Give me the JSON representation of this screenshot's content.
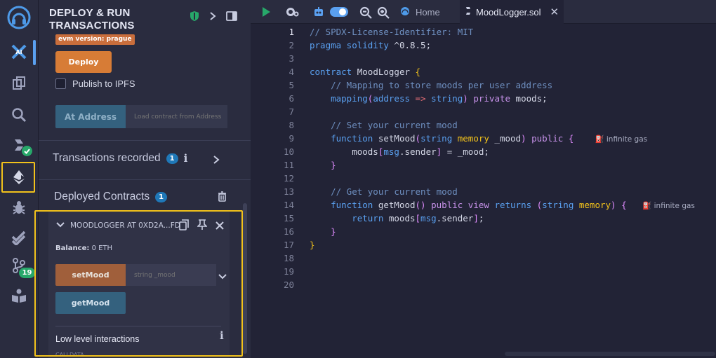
{
  "panel": {
    "title": "DEPLOY & RUN TRANSACTIONS",
    "evm_version": "evm version: prague",
    "deploy_label": "Deploy",
    "publish_ipfs_label": "Publish to IPFS",
    "at_address_label": "At Address",
    "at_address_placeholder": "Load contract from Address",
    "transactions_label": "Transactions recorded",
    "transactions_count": "1",
    "deployed_label": "Deployed Contracts",
    "deployed_count": "1",
    "instance": {
      "title": "MOODLOGGER AT 0XD2A...FD",
      "balance_label": "Balance:",
      "balance_value": "0 ETH",
      "setmood_label": "setMood",
      "setmood_placeholder": "string _mood",
      "getmood_label": "getMood",
      "low_level_label": "Low level interactions",
      "calldata_label": "CALLDATA"
    }
  },
  "iconbar": {
    "badge_count": "19",
    "icons": [
      "remix-logo-icon",
      "ai-icon",
      "file-explorer-icon",
      "search-icon",
      "solidity-compiler-icon",
      "deploy-run-icon",
      "debugger-icon",
      "test-icon",
      "git-icon",
      "learn-icon"
    ]
  },
  "tabs": {
    "home_label": "Home",
    "file_label": "MoodLogger.sol"
  },
  "editor": {
    "line_numbers": [
      "1",
      "2",
      "3",
      "4",
      "5",
      "6",
      "7",
      "8",
      "9",
      "10",
      "11",
      "12",
      "13",
      "14",
      "15",
      "16",
      "17",
      "18",
      "19",
      "20"
    ],
    "lines": {
      "l1": "// SPDX-License-Identifier: MIT",
      "l2_kw": "pragma solidity",
      "l2_ver": " ^0.8.5;",
      "l4_kw": "contract",
      "l4_name": " MoodLogger ",
      "l4_brace": "{",
      "l5": "    // Mapping to store moods per user address",
      "l6_kw": "    mapping",
      "l6_a": "(",
      "l6_addr": "address",
      "l6_arrow": " => ",
      "l6_str": "string",
      "l6_b": ")",
      "l6_priv": " private",
      "l6_rest": " moods;",
      "l8": "    // Set your current mood",
      "l9_kw": "    function",
      "l9_name": " setMood",
      "l9_p": "(",
      "l9_str": "string",
      "l9_mem": " memory",
      "l9_arg": " _mood",
      "l9_pc": ")",
      "l9_pub": " public",
      "l9_brace": " {",
      "l9_gas": "infinite gas",
      "l10_a": "        moods",
      "l10_b": "[",
      "l10_msg": "msg",
      "l10_c": ".sender",
      "l10_d": "]",
      "l10_e": " = _mood;",
      "l11": "    }",
      "l13": "    // Get your current mood",
      "l14_kw": "    function",
      "l14_name": " getMood",
      "l14_p": "()",
      "l14_pub": " public",
      "l14_view": " view",
      "l14_ret": " returns",
      "l14_p2": " (",
      "l14_str": "string",
      "l14_mem": " memory",
      "l14_pc": ")",
      "l14_brace": " {",
      "l14_gas": "infinite gas",
      "l15_kw": "        return",
      "l15_a": " moods",
      "l15_b": "[",
      "l15_msg": "msg",
      "l15_c": ".sender",
      "l15_d": "]",
      "l15_e": ";",
      "l16": "    }",
      "l17": "}"
    }
  },
  "colors": {
    "accent_orange": "#d77c36",
    "accent_blue": "#34617e",
    "highlight_yellow": "#f2c21b",
    "badge_green": "#27a86a"
  }
}
